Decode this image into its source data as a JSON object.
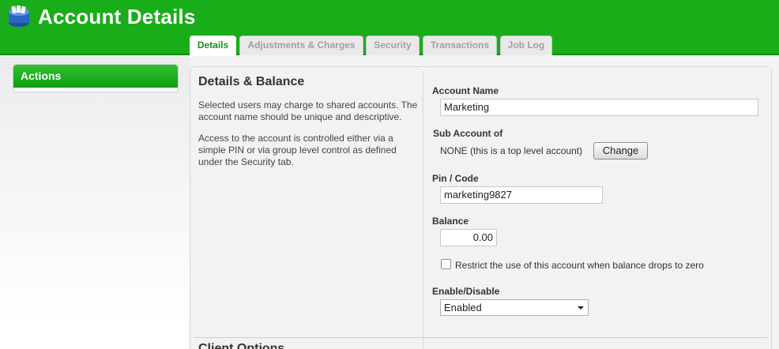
{
  "header": {
    "title": "Account Details",
    "tabs": [
      {
        "label": "Details",
        "active": true
      },
      {
        "label": "Adjustments & Charges",
        "active": false
      },
      {
        "label": "Security",
        "active": false
      },
      {
        "label": "Transactions",
        "active": false
      },
      {
        "label": "Job Log",
        "active": false
      }
    ]
  },
  "sidebar": {
    "actions_title": "Actions"
  },
  "details": {
    "section_title": "Details & Balance",
    "description_1": "Selected users may charge to shared accounts. The account name should be unique and descriptive.",
    "description_2": "Access to the account is controlled either via a simple PIN or via group level control as defined under the Security tab.",
    "account_name_label": "Account Name",
    "account_name_value": "Marketing",
    "sub_account_label": "Sub Account of",
    "sub_account_value": "NONE (this is a top level account)",
    "change_button": "Change",
    "pin_label": "Pin / Code",
    "pin_value": "marketing9827",
    "balance_label": "Balance",
    "balance_value": "0.00",
    "restrict_checkbox_label": "Restrict the use of this account when balance drops to zero",
    "restrict_checked": false,
    "enable_label": "Enable/Disable",
    "enable_selected": "Enabled"
  },
  "next_section_title": "Client Options",
  "colors": {
    "header_green": "#19ad19",
    "tab_active_text": "#1b8f1b"
  }
}
